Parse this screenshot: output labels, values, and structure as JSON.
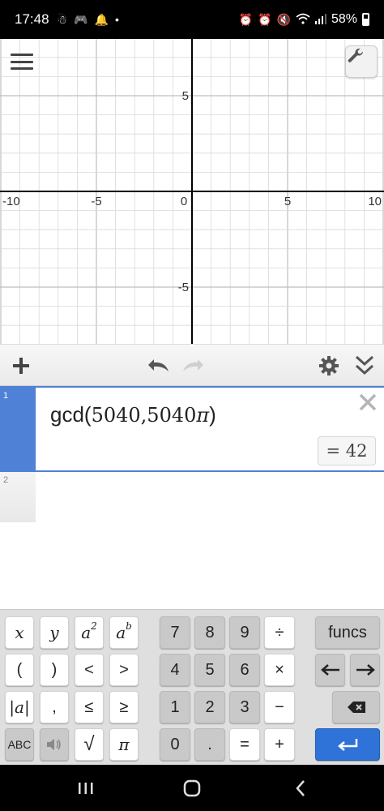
{
  "status_bar": {
    "time": "17:48",
    "battery": "58%",
    "left_icons": [
      "notification-icon",
      "game-icon",
      "bell-icon",
      "dot-icon"
    ],
    "right_icons": [
      "alarm-lock-icon",
      "alarm-icon",
      "mute-icon",
      "wifi-icon",
      "signal-icon"
    ]
  },
  "graph": {
    "x_ticks": [
      "-10",
      "-5",
      "0",
      "5",
      "10"
    ],
    "y_ticks": [
      "5",
      "-5"
    ],
    "xlim": [
      -10,
      10
    ],
    "ylim": [
      -8,
      10
    ]
  },
  "toolbar": {
    "add_icon": "plus-icon",
    "undo_icon": "undo-icon",
    "redo_icon": "redo-icon",
    "settings_icon": "gear-icon",
    "collapse_icon": "double-chevron-down-icon"
  },
  "expressions": [
    {
      "number": "1",
      "func": "gcd",
      "open": "(",
      "args": "5040,5040",
      "pi": "π",
      "close": ")",
      "result": "= 42"
    },
    {
      "number": "2"
    }
  ],
  "keypad": {
    "left": [
      [
        "x",
        "y",
        "a2",
        "ab"
      ],
      [
        "(",
        ")",
        "<",
        ">"
      ],
      [
        "|a|",
        ",",
        "≤",
        "≥"
      ],
      [
        "ABC",
        "speaker",
        "√",
        "π"
      ]
    ],
    "middle": [
      [
        "7",
        "8",
        "9",
        "÷"
      ],
      [
        "4",
        "5",
        "6",
        "×"
      ],
      [
        "1",
        "2",
        "3",
        "−"
      ],
      [
        "0",
        ".",
        "=",
        "+"
      ]
    ],
    "funcs": "funcs",
    "labels": {
      "a_base": "a",
      "a_sq_exp": "2",
      "a_b_exp": "b",
      "abs": "|a|",
      "abc": "ABC"
    }
  },
  "colors": {
    "accent": "#4f81d6",
    "enter_key": "#2f72d8",
    "axis": "#000000",
    "grid": "#d9d9d9"
  }
}
